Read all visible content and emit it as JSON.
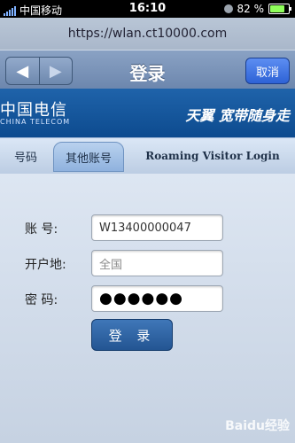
{
  "status": {
    "carrier": "中国移动",
    "time": "16:10",
    "battery": "82 %",
    "battery_level": 0.82
  },
  "browser": {
    "url": "https://wlan.ct10000.com",
    "title": "登录",
    "cancel_label": "取消"
  },
  "banner": {
    "logo_cn": "中国电信",
    "logo_en": "CHINA TELECOM",
    "slogan": "天翼 宽带随身走"
  },
  "tabs": [
    {
      "label": "号码"
    },
    {
      "label": "其他账号"
    },
    {
      "label": "Roaming Visitor Login"
    }
  ],
  "form": {
    "account_label": "账  号:",
    "account_value": "W13400000047",
    "region_label": "开户地:",
    "region_placeholder": "全国",
    "password_label": "密  码:",
    "password_value": "●●●●●●",
    "login_label": "登 录"
  },
  "watermark": "Baidu经验"
}
